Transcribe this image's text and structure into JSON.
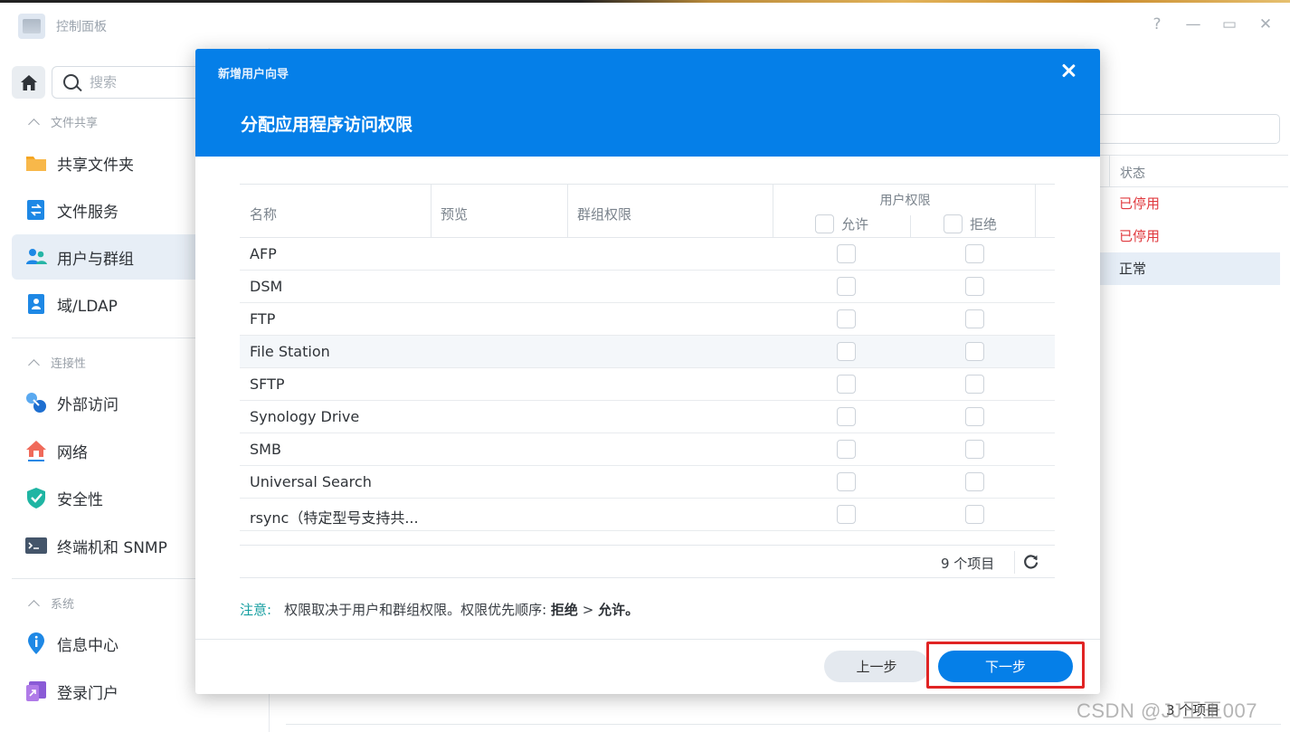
{
  "window": {
    "title": "控制面板",
    "help": "?",
    "minimize": "—",
    "maximize": "▭",
    "close": "✕"
  },
  "sidebar": {
    "search_placeholder": "搜索",
    "sections": [
      {
        "title": "文件共享",
        "items": [
          {
            "label": "共享文件夹",
            "icon": "folder-icon"
          },
          {
            "label": "文件服务",
            "icon": "file-services-icon"
          },
          {
            "label": "用户与群组",
            "icon": "users-icon",
            "active": true
          },
          {
            "label": "域/LDAP",
            "icon": "ldap-icon"
          }
        ]
      },
      {
        "title": "连接性",
        "items": [
          {
            "label": "外部访问",
            "icon": "external-access-icon"
          },
          {
            "label": "网络",
            "icon": "network-icon"
          },
          {
            "label": "安全性",
            "icon": "shield-icon"
          },
          {
            "label": "终端机和 SNMP",
            "icon": "terminal-icon"
          }
        ]
      },
      {
        "title": "系统",
        "items": [
          {
            "label": "信息中心",
            "icon": "info-icon"
          },
          {
            "label": "登录门户",
            "icon": "login-portal-icon"
          }
        ]
      }
    ]
  },
  "background": {
    "status_header": "状态",
    "rows": [
      "已停用",
      "已停用",
      "正常"
    ],
    "bottom_count": "3 个项目"
  },
  "modal": {
    "wizard_title": "新增用户向导",
    "step_title": "分配应用程序访问权限",
    "columns": {
      "name": "名称",
      "preview": "预览",
      "group_perm": "群组权限",
      "user_perm": "用户权限",
      "allow": "允许",
      "deny": "拒绝"
    },
    "rows": [
      {
        "name": "AFP"
      },
      {
        "name": "DSM"
      },
      {
        "name": "FTP"
      },
      {
        "name": "File Station"
      },
      {
        "name": "SFTP"
      },
      {
        "name": "Synology Drive"
      },
      {
        "name": "SMB"
      },
      {
        "name": "Universal Search"
      },
      {
        "name": "rsync（特定型号支持共..."
      }
    ],
    "item_count": "9 个项目",
    "note_label": "注意:",
    "note_text": "权限取决于用户和群组权限。权限优先顺序:",
    "note_deny": "拒绝",
    "note_gt": ">",
    "note_allow": "允许",
    "note_end": "。",
    "prev_button": "上一步",
    "next_button": "下一步"
  },
  "watermark": "CSDN @JJ王王007",
  "colors": {
    "primary": "#057fe8",
    "disabled_status": "#e0393e",
    "note_label": "#149ea0",
    "highlight_frame": "#e02424"
  }
}
